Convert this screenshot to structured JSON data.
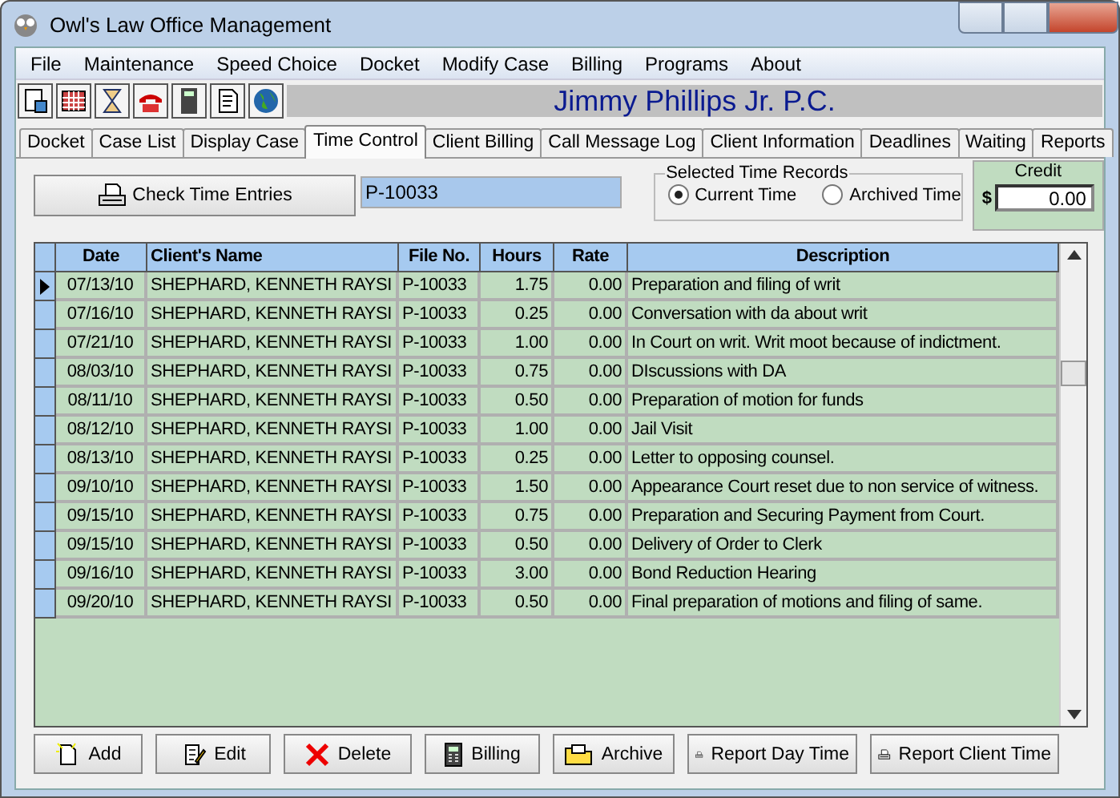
{
  "window": {
    "title": "Owl's Law Office Management"
  },
  "menu": [
    "File",
    "Maintenance",
    "Speed Choice",
    "Docket",
    "Modify Case",
    "Billing",
    "Programs",
    "About"
  ],
  "toolbar": {
    "firm_name": "Jimmy Phillips Jr. P.C."
  },
  "tabs": [
    {
      "label": "Docket",
      "selected": false
    },
    {
      "label": "Case List",
      "selected": false
    },
    {
      "label": "Display Case",
      "selected": false
    },
    {
      "label": "Time Control",
      "selected": true
    },
    {
      "label": "Client Billing",
      "selected": false
    },
    {
      "label": "Call Message Log",
      "selected": false
    },
    {
      "label": "Client Information",
      "selected": false
    },
    {
      "label": "Deadlines",
      "selected": false
    },
    {
      "label": "Waiting",
      "selected": false
    },
    {
      "label": "Reports",
      "selected": false
    }
  ],
  "check_button": "Check Time Entries",
  "file_field": {
    "value": "P-10033"
  },
  "records": {
    "title": "Selected Time Records",
    "options": [
      {
        "label": "Current Time",
        "selected": true
      },
      {
        "label": "Archived Time",
        "selected": false
      }
    ]
  },
  "credit": {
    "title": "Credit",
    "currency": "$",
    "value": "0.00"
  },
  "table": {
    "columns": [
      "Date",
      "Client's Name",
      "File No.",
      "Hours",
      "Rate",
      "Description"
    ],
    "rows": [
      {
        "current": true,
        "cells": [
          "07/13/10",
          "SHEPHARD, KENNETH RAYSI",
          "P-10033",
          "1.75",
          "0.00",
          "Preparation and filing of writ"
        ]
      },
      {
        "current": false,
        "cells": [
          "07/16/10",
          "SHEPHARD, KENNETH RAYSI",
          "P-10033",
          "0.25",
          "0.00",
          "Conversation with da about writ"
        ]
      },
      {
        "current": false,
        "cells": [
          "07/21/10",
          "SHEPHARD, KENNETH RAYSI",
          "P-10033",
          "1.00",
          "0.00",
          "In Court on writ.  Writ moot because of indictment."
        ]
      },
      {
        "current": false,
        "cells": [
          "08/03/10",
          "SHEPHARD, KENNETH RAYSI",
          "P-10033",
          "0.75",
          "0.00",
          "DIscussions with DA"
        ]
      },
      {
        "current": false,
        "cells": [
          "08/11/10",
          "SHEPHARD, KENNETH RAYSI",
          "P-10033",
          "0.50",
          "0.00",
          "Preparation of motion for funds"
        ]
      },
      {
        "current": false,
        "cells": [
          "08/12/10",
          "SHEPHARD, KENNETH RAYSI",
          "P-10033",
          "1.00",
          "0.00",
          "Jail Visit"
        ]
      },
      {
        "current": false,
        "cells": [
          "08/13/10",
          "SHEPHARD, KENNETH RAYSI",
          "P-10033",
          "0.25",
          "0.00",
          "Letter to opposing counsel."
        ]
      },
      {
        "current": false,
        "cells": [
          "09/10/10",
          "SHEPHARD, KENNETH RAYSI",
          "P-10033",
          "1.50",
          "0.00",
          "Appearance Court reset due to non service of witness."
        ]
      },
      {
        "current": false,
        "cells": [
          "09/15/10",
          "SHEPHARD, KENNETH RAYSI",
          "P-10033",
          "0.75",
          "0.00",
          "Preparation and Securing Payment from Court."
        ]
      },
      {
        "current": false,
        "cells": [
          "09/15/10",
          "SHEPHARD, KENNETH RAYSI",
          "P-10033",
          "0.50",
          "0.00",
          "Delivery of Order to Clerk"
        ]
      },
      {
        "current": false,
        "cells": [
          "09/16/10",
          "SHEPHARD, KENNETH RAYSI",
          "P-10033",
          "3.00",
          "0.00",
          "Bond Reduction Hearing"
        ]
      },
      {
        "current": false,
        "cells": [
          "09/20/10",
          "SHEPHARD, KENNETH RAYSI",
          "P-10033",
          "0.50",
          "0.00",
          "Final preparation of motions and filing of same."
        ]
      }
    ]
  },
  "buttons": [
    {
      "label": "Add",
      "kind": "add"
    },
    {
      "label": "Edit",
      "kind": "edit"
    },
    {
      "label": "Delete",
      "kind": "delete"
    },
    {
      "label": "Billing",
      "kind": "billing"
    },
    {
      "label": "Archive",
      "kind": "archive"
    },
    {
      "label": "Report Day Time",
      "kind": "print"
    },
    {
      "label": "Report Client Time",
      "kind": "print"
    }
  ]
}
